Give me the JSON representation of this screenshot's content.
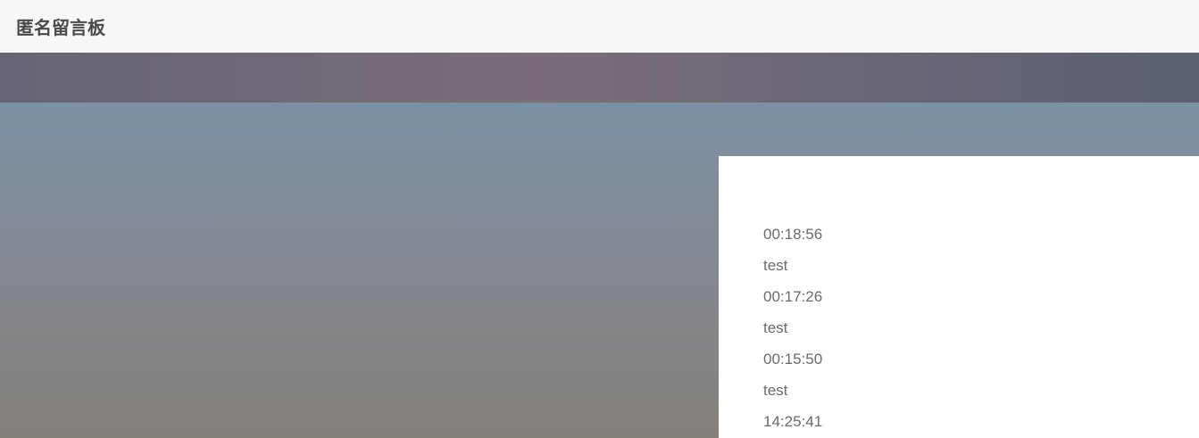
{
  "navbar": {
    "brand": "匿名留言板"
  },
  "messages": [
    {
      "time": "00:18:56",
      "text": "test"
    },
    {
      "time": "00:17:26",
      "text": "test"
    },
    {
      "time": "00:15:50",
      "text": "test"
    },
    {
      "time": "14:25:41",
      "text": ""
    }
  ]
}
